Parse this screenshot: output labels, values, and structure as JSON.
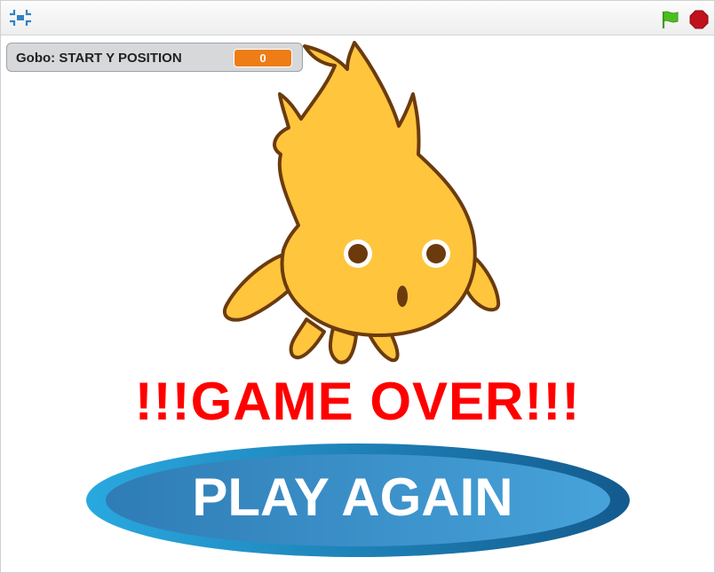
{
  "toolbar": {
    "fullscreen_icon": "fullscreen-icon",
    "green_flag_icon": "green-flag-icon",
    "stop_icon": "stop-sign-icon",
    "flag_color": "#4cbf1f",
    "stop_color": "#c0121c"
  },
  "monitor": {
    "label": "Gobo: START Y POSITION",
    "value": "0",
    "value_color": "#ee7d16"
  },
  "sprite": {
    "name": "Gobo",
    "fill_color": "#ffc53d",
    "outline_color": "#6b3b0e"
  },
  "game_over_text": "!!!GAME OVER!!!",
  "game_over_color": "#ff0000",
  "play_again": {
    "label": "PLAY AGAIN",
    "outer_color": "#1e6fa6",
    "inner_color": "#3b95d0"
  }
}
